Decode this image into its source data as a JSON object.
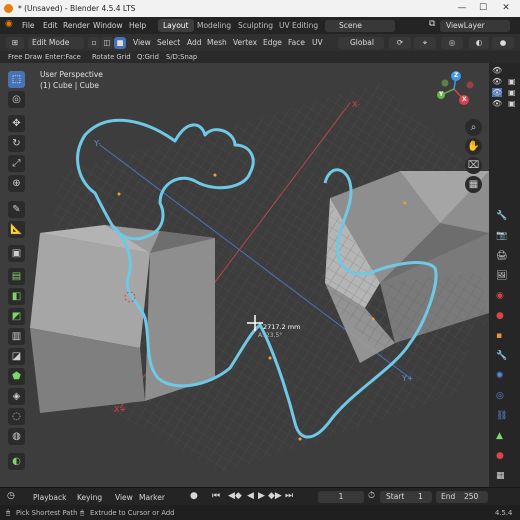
{
  "window": {
    "title": "* (Unsaved) - Blender 4.5.4 LTS",
    "minimize": "—",
    "maximize": "☐",
    "close": "✕"
  },
  "menu": [
    "File",
    "Edit",
    "Render",
    "Window",
    "Help"
  ],
  "workspaces": [
    "Layout",
    "Modeling",
    "Sculpting",
    "UV Editing"
  ],
  "active_workspace": "Layout",
  "scene": "Scene",
  "view_layer": "ViewLayer",
  "header": {
    "mode": "Edit Mode",
    "menus": [
      "View",
      "Select",
      "Add",
      "Mesh",
      "Vertex",
      "Edge",
      "Face",
      "UV"
    ],
    "orientation": "Global"
  },
  "hints": [
    "Free Draw",
    "Enter:Face",
    "Rotate Grid",
    "Q:Grid",
    "S/D:Snap"
  ],
  "viewport": {
    "perspective": "User Perspective",
    "object": "(1) Cube | Cube",
    "measure": "2717.2 mm",
    "angle": "A: 23.5°",
    "axis_labels": {
      "x_neg": "X-",
      "x_pos": "X+",
      "y_neg": "Y-",
      "y_pos": "Y+"
    },
    "gizmo": {
      "x": "X",
      "y": "Y",
      "z": "Z"
    }
  },
  "timeline": {
    "menus": [
      "Playback",
      "Keying",
      "View",
      "Marker"
    ],
    "current_frame": "1",
    "start_label": "Start",
    "start": "1",
    "end_label": "End",
    "end": "250"
  },
  "status": {
    "left": "Pick Shortest Path",
    "middle": "Extrude to Cursor or Add",
    "version": "4.5.4"
  },
  "colors": {
    "accent": "#4772b3",
    "stroke": "#6fc8e6",
    "x_axis": "#d9414b",
    "y_axis": "#5c8de0",
    "z_axis": "#3e9ae6"
  }
}
